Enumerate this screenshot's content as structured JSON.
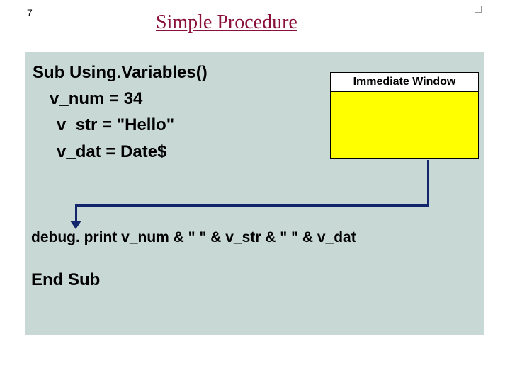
{
  "slideNumber": "7",
  "title": "Simple Procedure",
  "code": {
    "line1": "Sub Using.Variables()",
    "line2": "v_num = 34",
    "line3": "v_str = \"Hello\"",
    "line4": "v_dat = Date$",
    "debug": "debug. print v_num & \"  \" & v_str  & \"  \" & v_dat",
    "end": "End Sub"
  },
  "immediateWindow": {
    "title": "Immediate Window"
  }
}
